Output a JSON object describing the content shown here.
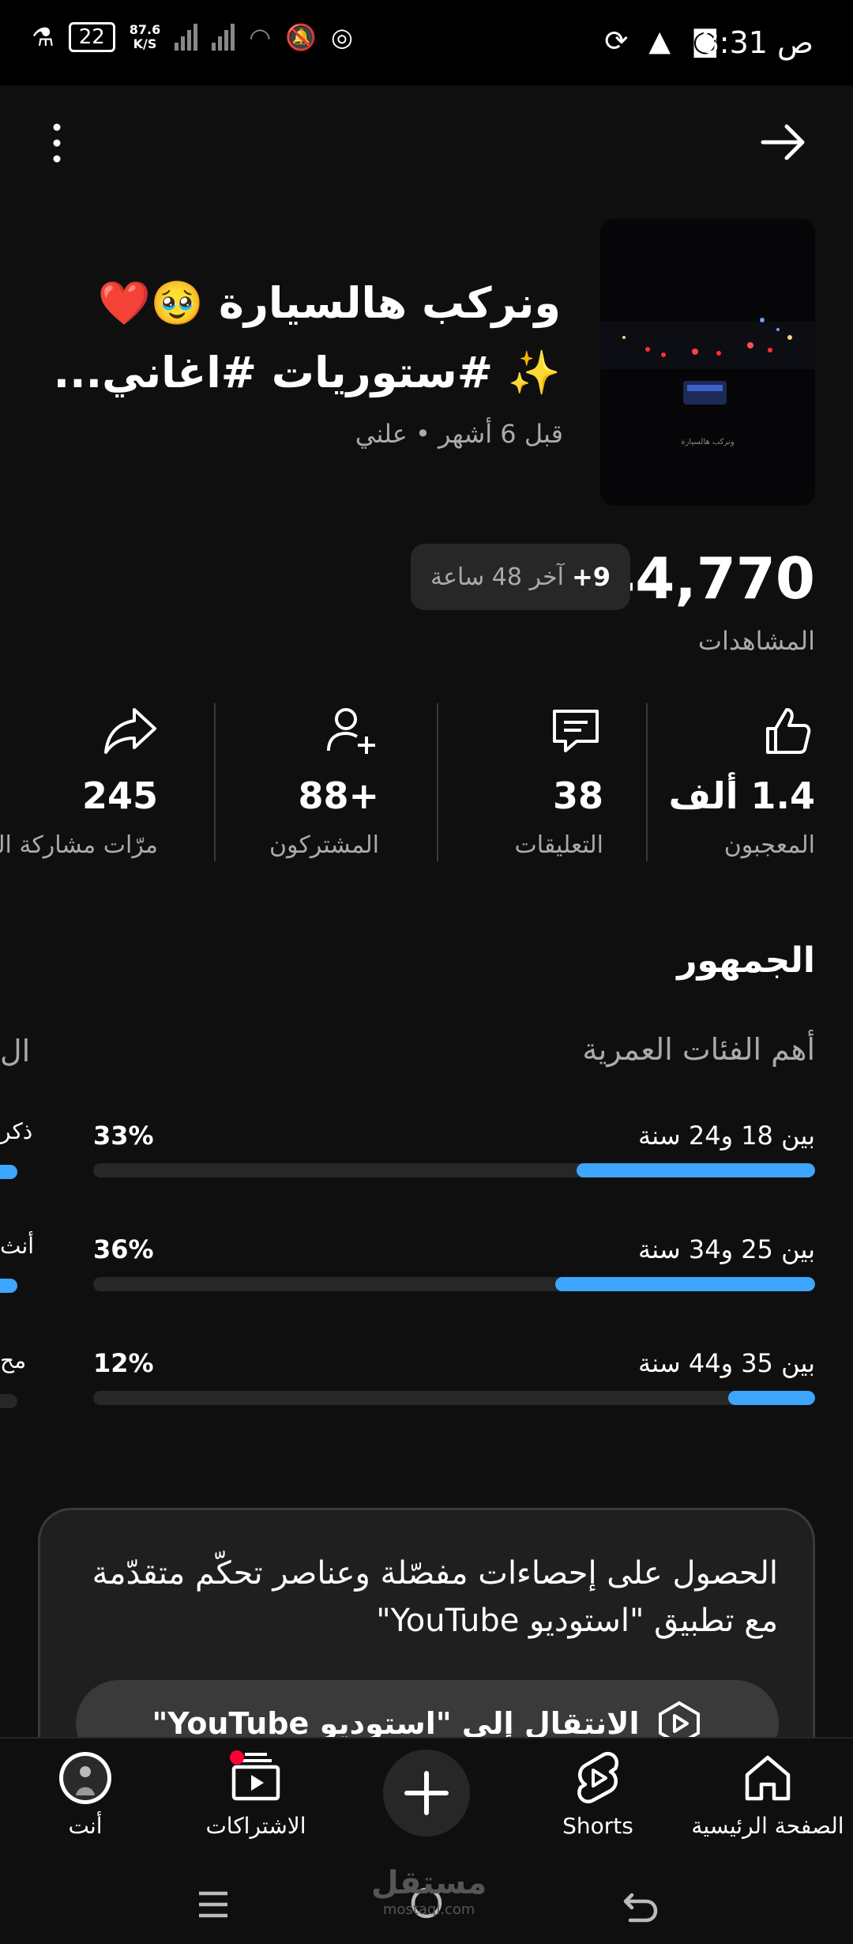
{
  "status_bar": {
    "time": "8:31",
    "ampm": "ص",
    "battery": "22",
    "speed_value": "87.6",
    "speed_unit": "K/S"
  },
  "video": {
    "title_line1": "ونركب هالسيارة 🥹❤️",
    "title_line2": "✨ #ستوريات #اغاني...",
    "meta": "قبل 6 أشهر • علني",
    "thumb_caption": "ونركب هالسيارة"
  },
  "views": {
    "value": "44,770",
    "label": "المشاهدات",
    "chip_delta": "+9",
    "chip_text": "آخر 48 ساعة"
  },
  "stats": [
    {
      "value": "1.4 ألف",
      "label": "المعجبون",
      "icon": "thumbs-up-icon"
    },
    {
      "value": "38",
      "label": "التعليقات",
      "icon": "comment-icon"
    },
    {
      "value": "+88",
      "label": "المشتركون",
      "icon": "add-person-icon"
    },
    {
      "value": "245",
      "label": "مرّات مشاركة الـ",
      "icon": "share-icon"
    }
  ],
  "audience": {
    "title": "الجمهور",
    "age_title": "أهم الفئات العمرية",
    "cut_title": "ال",
    "cut_labels": [
      "ذكر",
      "أنث",
      "مح"
    ],
    "ages": [
      {
        "label": "بين 18 و24 سنة",
        "pct_text": "33%",
        "pct": 0.33,
        "left_frag": 0.6
      },
      {
        "label": "بين 25 و34 سنة",
        "pct_text": "36%",
        "pct": 0.36,
        "left_frag": 0.6
      },
      {
        "label": "بين 35 و44 سنة",
        "pct_text": "12%",
        "pct": 0.12,
        "left_frag": 0.1
      }
    ]
  },
  "studio_card": {
    "text": "الحصول على إحصاءات مفصّلة وعناصر تحكّم متقدّمة مع تطبيق \"استوديو YouTube\"",
    "button": "الانتقال إلى \"استوديو YouTube\""
  },
  "bottom_nav": {
    "home": "الصفحة الرئيسية",
    "shorts": "Shorts",
    "subscriptions": "الاشتراكات",
    "you": "أنت"
  },
  "watermark": {
    "text": "مستقل",
    "sub": "mostaql.com"
  },
  "colors": {
    "accent": "#3ea6ff",
    "background": "#0f0f0f",
    "badge": "#ff0033"
  }
}
